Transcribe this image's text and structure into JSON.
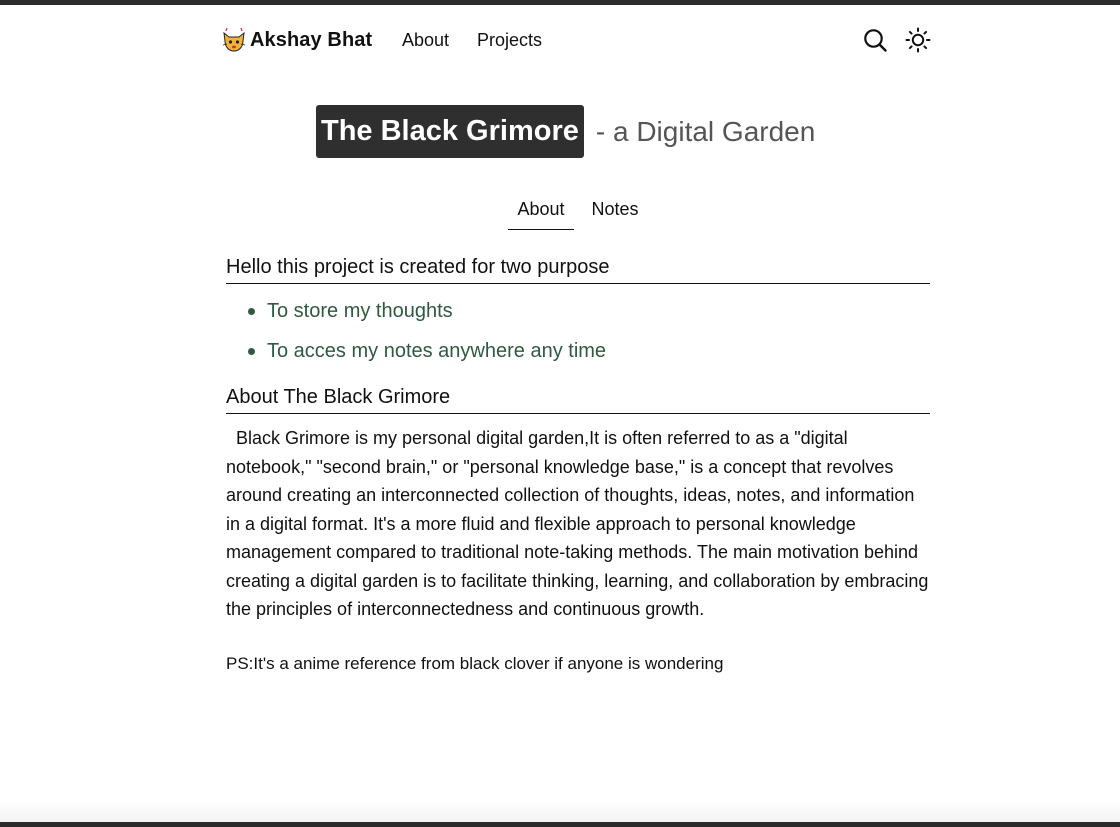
{
  "nav": {
    "brand": "Akshay Bhat",
    "links": [
      "About",
      "Projects"
    ],
    "icons": {
      "logo": "cat-face-icon",
      "search": "search-icon",
      "theme": "sun-icon"
    }
  },
  "hero": {
    "title": "The Black Grimore",
    "subtitle": "- a Digital Garden"
  },
  "tabs": [
    {
      "label": "About",
      "active": true
    },
    {
      "label": "Notes",
      "active": false
    }
  ],
  "content": {
    "heading1": "Hello this project is created for two purpose",
    "purposes": [
      "To store my thoughts",
      "To acces my notes anywhere any time"
    ],
    "heading2": "About The Black Grimore",
    "paragraph": "Black Grimore is my personal digital garden,It is often referred to as a \"digital notebook,\" \"second brain,\" or \"personal knowledge base,\" is a concept that revolves around creating an interconnected collection of thoughts, ideas, notes, and information in a digital format. It's a more fluid and flexible approach to personal knowledge management compared to traditional note-taking methods. The main motivation behind creating a digital garden is to facilitate thinking, learning, and collaboration by embracing the principles of interconnectedness and continuous growth.",
    "ps": "PS:It's a anime reference from black clover if anyone is wondering"
  },
  "colors": {
    "accent_green": "#2f5a40",
    "title_bg": "#2f2f2f",
    "subtitle": "#555555"
  }
}
